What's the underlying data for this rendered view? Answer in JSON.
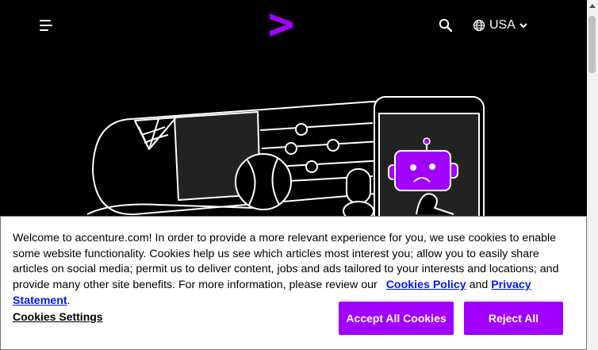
{
  "header": {
    "country_label": "USA",
    "brand_color": "#a100ff",
    "icons": [
      "menu-icon",
      "accenture-logo",
      "search-icon",
      "globe-icon",
      "chevron-down-icon"
    ]
  },
  "cookie_banner": {
    "text_before": "Welcome to accenture.com! In order to provide a more relevant experience for you, we use cookies to enable some website functionality. Cookies help us see which articles most interest you; allow you to easily share articles on social media; permit us to deliver content, jobs and ads tailored to your interests and locations; and provide many other site benefits. For more information, please review our",
    "cookies_policy_link": "Cookies Policy",
    "conjunction": "and",
    "privacy_link": "Privacy Statement",
    "period": ".",
    "settings_label": "Cookies Settings",
    "accept_label": "Accept All Cookies",
    "reject_label": "Reject All"
  }
}
